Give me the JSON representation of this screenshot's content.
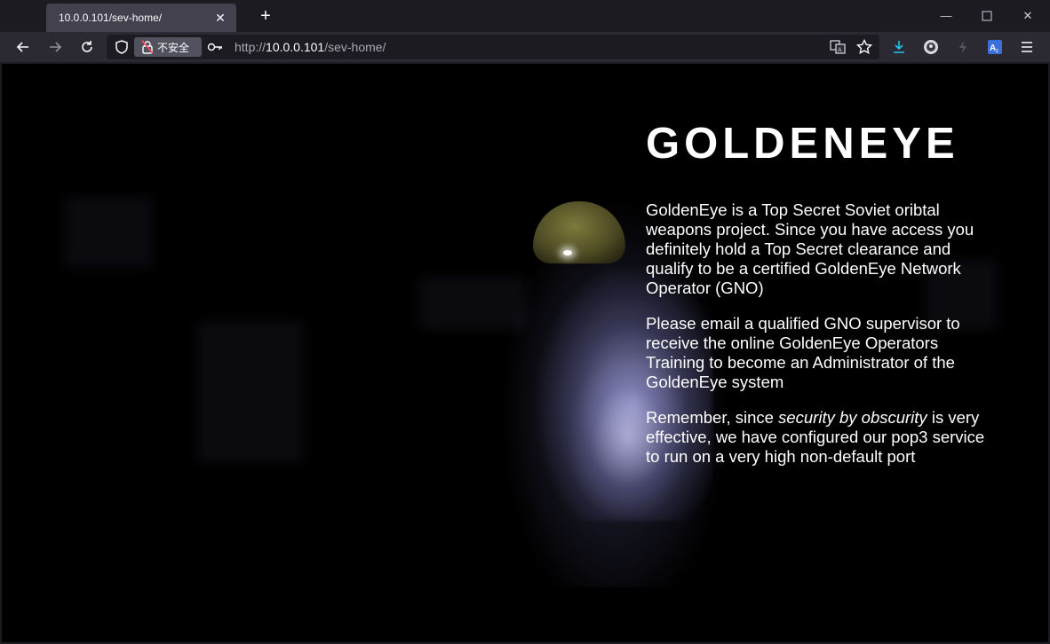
{
  "browser": {
    "tab": {
      "title": "10.0.0.101/sev-home/"
    },
    "address": {
      "security_label": "不安全",
      "url_prefix": "http://",
      "url_host": "10.0.0.101",
      "url_path": "/sev-home/"
    }
  },
  "page": {
    "heading": "GOLDENEYE",
    "p1": "GoldenEye is a Top Secret Soviet oribtal weapons project. Since you have access you definitely hold a Top Secret clearance and qualify to be a certified GoldenEye Network Operator (GNO)",
    "p2": "Please email a qualified GNO supervisor to receive the online GoldenEye Operators Training to become an Administrator of the GoldenEye system",
    "p3_before": "Remember, since ",
    "p3_em": "security by obscurity",
    "p3_after": " is very effective, we have configured our pop3 service to run on a very high non-default port"
  },
  "colors": {
    "tabstrip": "#1c1b22",
    "navbar": "#2b2a33",
    "urlbar": "#1c1b22",
    "content_bg": "#000000",
    "text": "#ffffff",
    "download_accent": "#22c1f0"
  },
  "icons": [
    "back-icon",
    "forward-icon",
    "reload-icon",
    "shield-icon",
    "lock-insecure-icon",
    "key-icon",
    "translate-icon",
    "star-icon",
    "download-icon",
    "account-icon",
    "extension-icon",
    "translate-ext-icon",
    "menu-icon",
    "close-icon",
    "new-tab-icon",
    "minimize-icon",
    "maximize-icon"
  ]
}
